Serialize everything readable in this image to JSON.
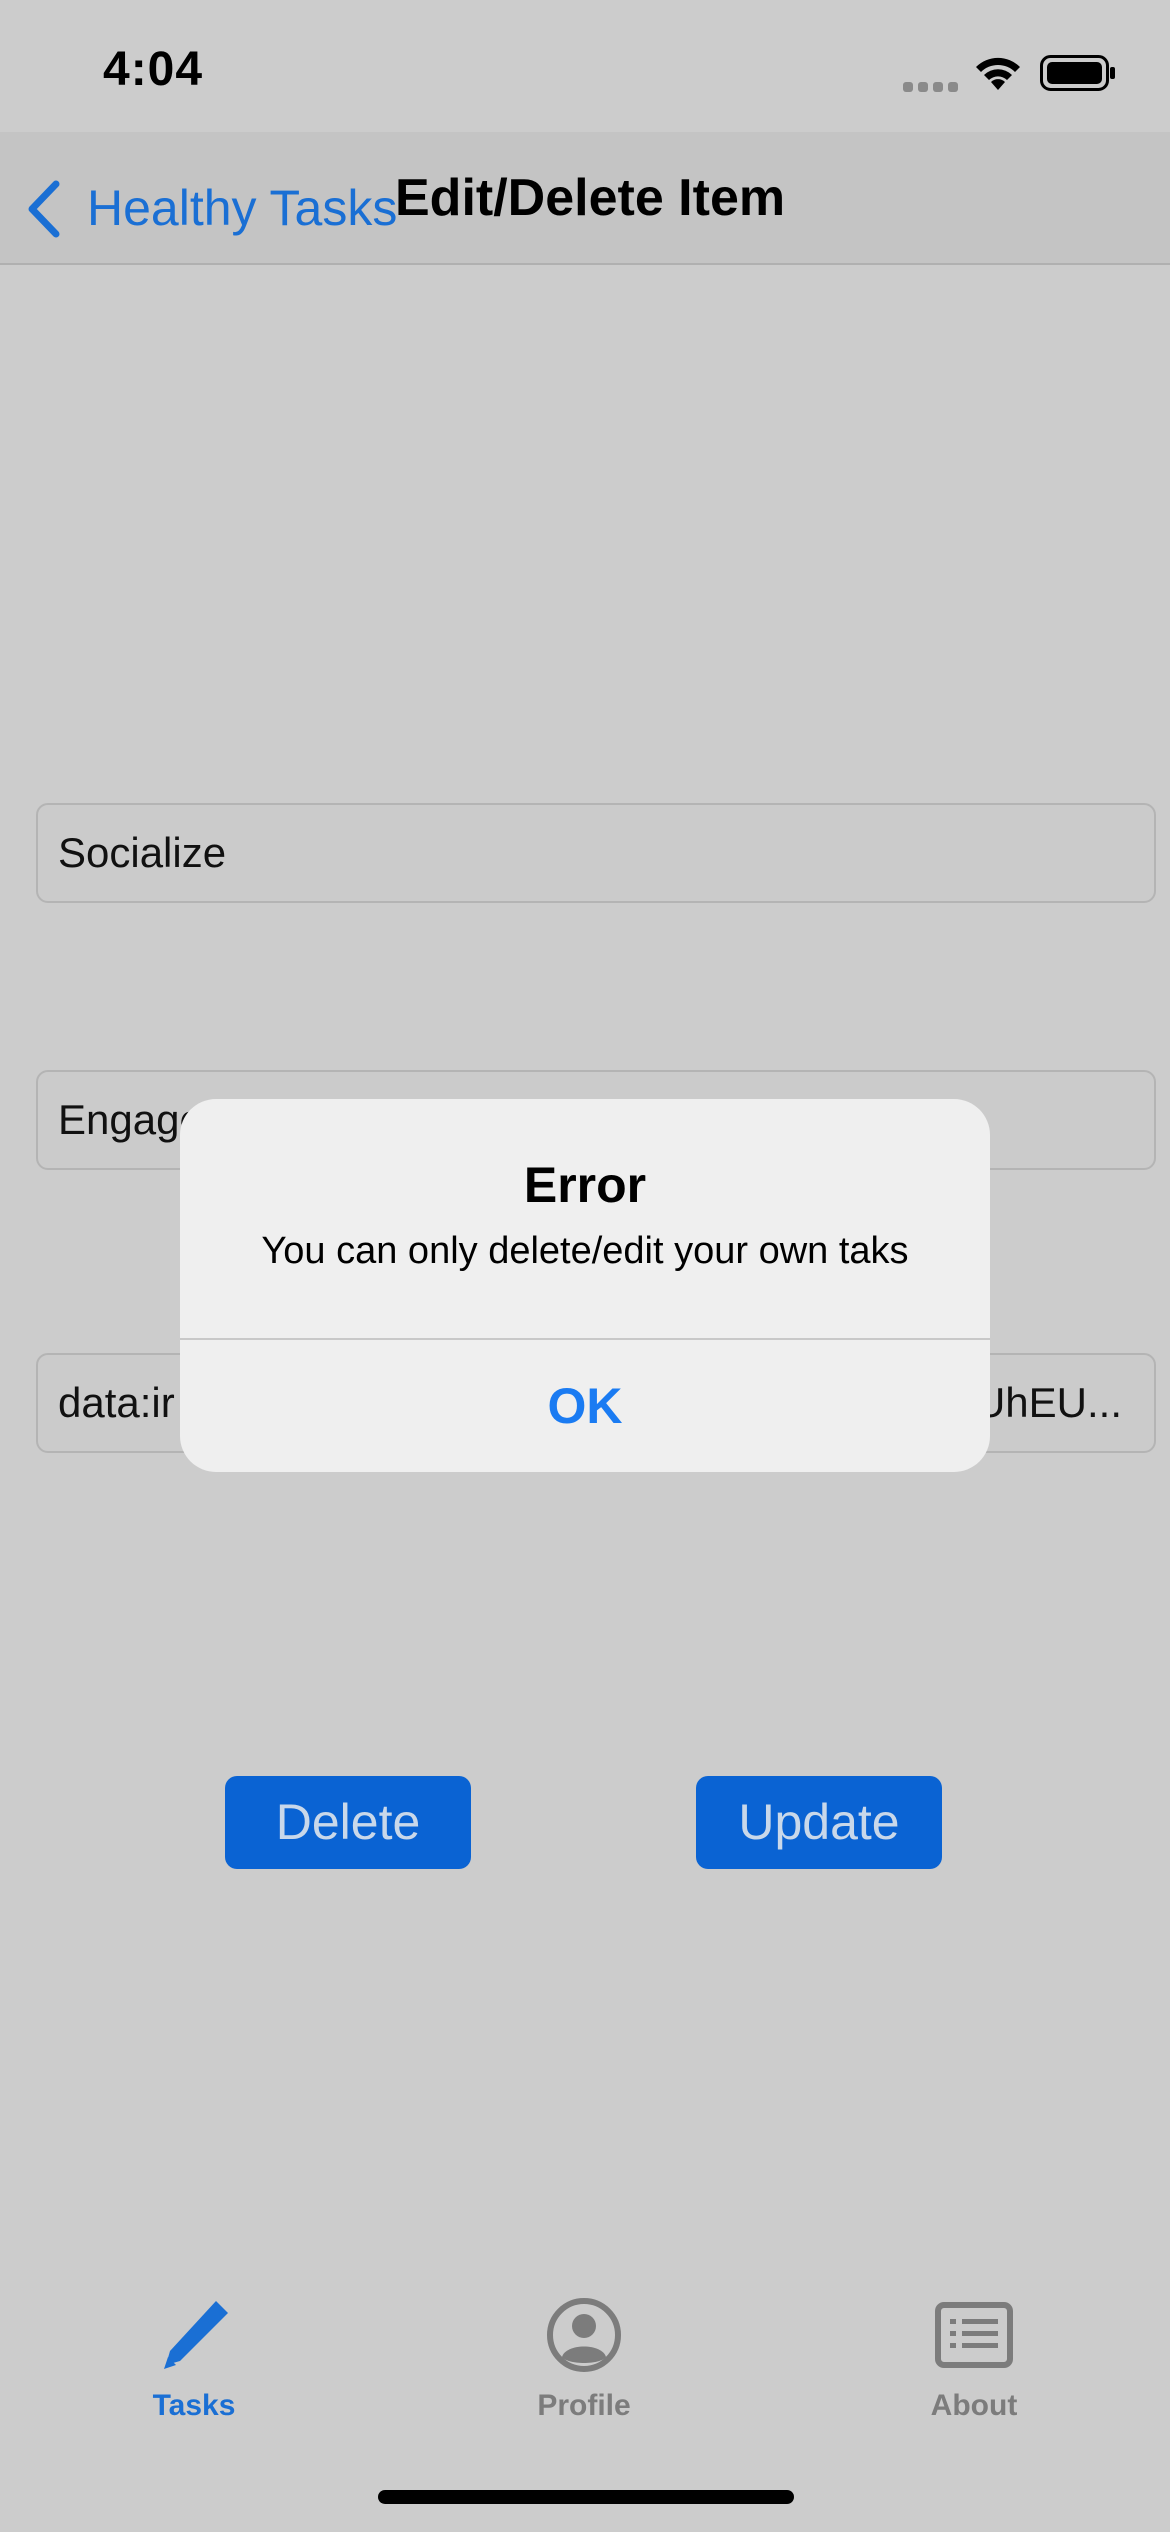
{
  "status_bar": {
    "time": "4:04"
  },
  "nav": {
    "back_label": "Healthy Tasks",
    "title": "Edit/Delete Item"
  },
  "form": {
    "name_value": "Socialize",
    "description_value_visible": "Engage",
    "image_value_start": "data:ir",
    "image_value_end": "UhEU..."
  },
  "buttons": {
    "delete_label": "Delete",
    "update_label": "Update"
  },
  "tab_bar": {
    "items": [
      {
        "label": "Tasks",
        "icon": "pencil-icon",
        "selected": true
      },
      {
        "label": "Profile",
        "icon": "person-circle-icon",
        "selected": false
      },
      {
        "label": "About",
        "icon": "list-card-icon",
        "selected": false
      }
    ]
  },
  "alert": {
    "title": "Error",
    "message": "You can only delete/edit your own taks",
    "ok_label": "OK"
  },
  "colors": {
    "accent": "#1a7bf2",
    "button_bg": "#0a63d3",
    "tab_selected": "#1a6fd4",
    "tab_unselected": "#7c7c7c"
  }
}
